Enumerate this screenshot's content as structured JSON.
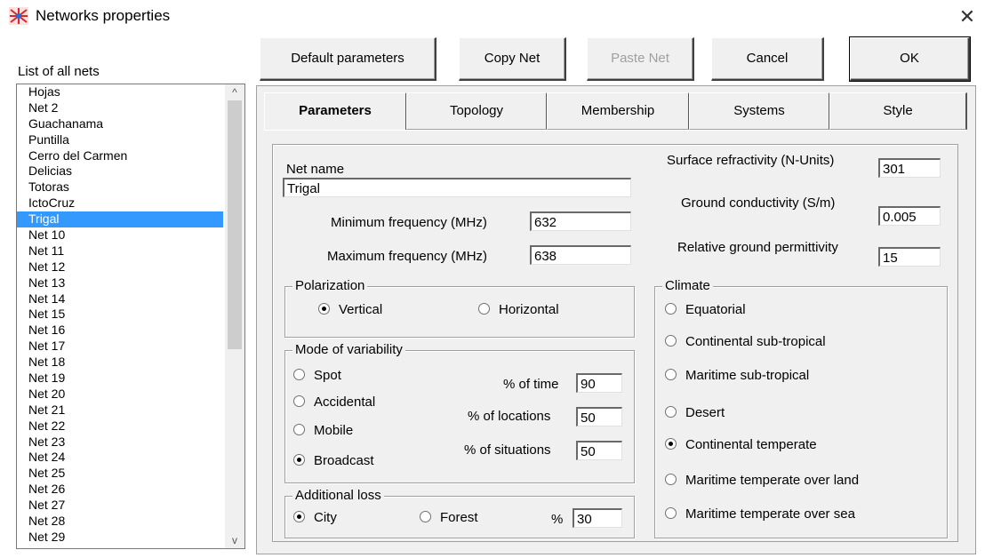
{
  "window": {
    "title": "Networks properties",
    "close_symbol": "✕"
  },
  "left_panel": {
    "label": "List of all nets",
    "items": [
      "Hojas",
      "Net  2",
      "Guachanama",
      "Puntilla",
      "Cerro del Carmen",
      "Delicias",
      "Totoras",
      "IctoCruz",
      "Trigal",
      "Net 10",
      "Net 11",
      "Net 12",
      "Net 13",
      "Net 14",
      "Net 15",
      "Net 16",
      "Net 17",
      "Net 18",
      "Net 19",
      "Net 20",
      "Net 21",
      "Net 22",
      "Net 23",
      "Net 24",
      "Net 25",
      "Net 26",
      "Net 27",
      "Net 28",
      "Net 29"
    ],
    "selected_index": 8,
    "scroll_up": "^",
    "scroll_down": "v"
  },
  "toolbar": {
    "default_parameters": "Default parameters",
    "copy_net": "Copy Net",
    "paste_net": "Paste Net",
    "cancel": "Cancel",
    "ok": "OK"
  },
  "tabs": [
    {
      "label": "Parameters",
      "active": true
    },
    {
      "label": "Topology",
      "active": false
    },
    {
      "label": "Membership",
      "active": false
    },
    {
      "label": "Systems",
      "active": false
    },
    {
      "label": "Style",
      "active": false
    }
  ],
  "parameters": {
    "net_name_label": "Net name",
    "net_name_value": "Trigal",
    "min_freq_label": "Minimum frequency (MHz)",
    "min_freq_value": "632",
    "max_freq_label": "Maximum frequency (MHz)",
    "max_freq_value": "638",
    "surface_refractivity_label": "Surface refractivity (N-Units)",
    "surface_refractivity_value": "301",
    "ground_conductivity_label": "Ground conductivity (S/m)",
    "ground_conductivity_value": "0.005",
    "relative_permittivity_label": "Relative ground permittivity",
    "relative_permittivity_value": "15"
  },
  "polarization": {
    "title": "Polarization",
    "options": [
      "Vertical",
      "Horizontal"
    ],
    "selected": "Vertical"
  },
  "variability": {
    "title": "Mode of variability",
    "options": [
      "Spot",
      "Accidental",
      "Mobile",
      "Broadcast"
    ],
    "selected": "Broadcast",
    "time_label": "% of time",
    "time_value": "90",
    "locations_label": "% of locations",
    "locations_value": "50",
    "situations_label": "% of situations",
    "situations_value": "50"
  },
  "additional_loss": {
    "title": "Additional loss",
    "options": [
      "City",
      "Forest"
    ],
    "selected": "City",
    "percent_label": "%",
    "percent_value": "30"
  },
  "climate": {
    "title": "Climate",
    "options": [
      "Equatorial",
      "Continental sub-tropical",
      "Maritime sub-tropical",
      "Desert",
      "Continental temperate",
      "Maritime temperate over land",
      "Maritime temperate over sea"
    ],
    "selected": "Continental temperate"
  }
}
